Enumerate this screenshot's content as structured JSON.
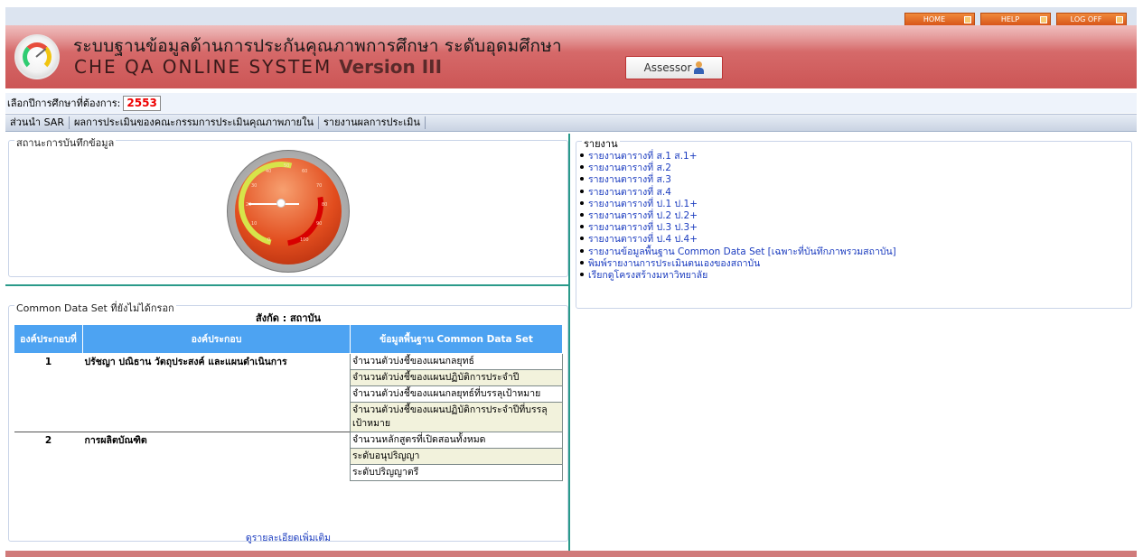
{
  "topnav": [
    {
      "label": "HOME"
    },
    {
      "label": "HELP"
    },
    {
      "label": "LOG OFF"
    }
  ],
  "header": {
    "title_th": "ระบบฐานข้อมูลด้านการประกันคุณภาพการศึกษา ระดับอุดมศึกษา",
    "title_en": "CHE QA ONLINE SYSTEM",
    "version": "Version III",
    "role_button": "Assessor"
  },
  "year": {
    "label": "เลือกปีการศึกษาที่ต้องการ:",
    "value": "2553"
  },
  "menu": [
    {
      "label": "ส่วนนำ SAR"
    },
    {
      "label": "ผลการประเมินของคณะกรรมการประเมินคุณภาพภายใน"
    },
    {
      "label": "รายงานผลการประเมิน"
    }
  ],
  "status": {
    "legend": "สถานะการบันทึกข้อมูล",
    "gauge_ticks": [
      "0",
      "10",
      "20",
      "30",
      "40",
      "50",
      "60",
      "70",
      "80",
      "90",
      "100"
    ]
  },
  "cds": {
    "legend": "Common Data Set ที่ยังไม่ได้กรอก",
    "affiliation": "สังกัด  : สถาบัน",
    "headers": [
      "องค์ประกอบที่",
      "องค์ประกอบ",
      "ข้อมูลพื้นฐาน  Common Data Set"
    ],
    "groups": [
      {
        "num": "1",
        "name": "ปรัชญา  ปณิธาน  วัตถุประสงค์  และแผนดำเนินการ",
        "items": [
          "จำนวนตัวบ่งชี้ของแผนกลยุทธ์",
          "จำนวนตัวบ่งชี้ของแผนปฏิบัติการประจำปี",
          "จำนวนตัวบ่งชี้ของแผนกลยุทธ์ที่บรรลุเป้าหมาย",
          "จำนวนตัวบ่งชี้ของแผนปฏิบัติการประจำปีที่บรรลุเป้าหมาย"
        ]
      },
      {
        "num": "2",
        "name": "การผลิตบัณฑิต",
        "items": [
          "จำนวนหลักสูตรที่เปิดสอนทั้งหมด",
          "ระดับอนุปริญญา",
          "ระดับปริญญาตรี"
        ]
      }
    ],
    "more_link": "ดูรายละเอียดเพิ่มเติม"
  },
  "reports": {
    "legend": "รายงาน",
    "items": [
      "รายงานตารางที่ ส.1  ส.1+",
      "รายงานตารางที่ ส.2",
      "รายงานตารางที่ ส.3",
      "รายงานตารางที่ ส.4",
      "รายงานตารางที่ ป.1  ป.1+",
      "รายงานตารางที่ ป.2  ป.2+",
      "รายงานตารางที่ ป.3  ป.3+",
      "รายงานตารางที่ ป.4  ป.4+",
      "รายงานข้อมูลพื้นฐาน Common Data Set [เฉพาะที่บันทึกภาพรวมสถาบัน]",
      "พิมพ์รายงานการประเมินตนเองของสถาบัน",
      "เรียกดูโครงสร้างมหาวิทยาลัย"
    ]
  },
  "colors": {
    "banner": "#cc5555",
    "accent_teal": "#2a9a8a",
    "table_header": "#4da3f2",
    "link": "#1a3bbf",
    "year_value": "#ee0000"
  }
}
